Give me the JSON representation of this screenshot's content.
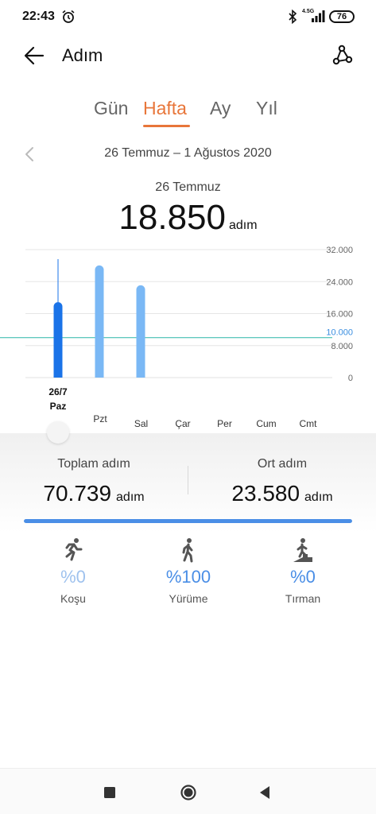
{
  "status_bar": {
    "time": "22:43",
    "network": "4.5G",
    "battery": "76"
  },
  "header": {
    "title": "Adım"
  },
  "tabs": [
    {
      "label": "Gün",
      "active": false
    },
    {
      "label": "Hafta",
      "active": true
    },
    {
      "label": "Ay",
      "active": false
    },
    {
      "label": "Yıl",
      "active": false
    }
  ],
  "period": {
    "range": "26 Temmuz – 1 Ağustos 2020"
  },
  "selected": {
    "date": "26 Temmuz",
    "value": "18.850",
    "unit": "adım"
  },
  "chart_data": {
    "type": "bar",
    "categories": [
      "Paz",
      "Pzt",
      "Sal",
      "Çar",
      "Per",
      "Cum",
      "Cmt"
    ],
    "values": [
      18850,
      28050,
      23080,
      0,
      0,
      0,
      0
    ],
    "selected_index": 0,
    "selected_label": "26/7",
    "y_ticks": [
      "32.000",
      "24.000",
      "16.000",
      "8.000",
      "0"
    ],
    "y_tick_values": [
      32000,
      24000,
      16000,
      8000,
      0
    ],
    "ylim": [
      0,
      32000
    ],
    "goal_value": 10000,
    "goal_label": "10.000",
    "grid": true,
    "colors": {
      "selected": "#1a73e8",
      "bar": "#7ab8f5",
      "goal": "#2bb5a8",
      "grid": "#e6e6e6"
    }
  },
  "summary": {
    "total_label": "Toplam adım",
    "total_value": "70.739",
    "avg_label": "Ort adım",
    "avg_value": "23.580",
    "unit": "adım",
    "progress": 1.0
  },
  "activity": [
    {
      "icon": "running-icon",
      "pct": "%0",
      "label": "Koşu",
      "color": "#9fc2ee"
    },
    {
      "icon": "walking-icon",
      "pct": "%100",
      "label": "Yürüme",
      "color": "#4a8ee6"
    },
    {
      "icon": "climbing-icon",
      "pct": "%0",
      "label": "Tırman",
      "color": "#4a8ee6"
    }
  ],
  "colors": {
    "accent": "#e8763a",
    "primary_blue": "#4a8ee6"
  }
}
